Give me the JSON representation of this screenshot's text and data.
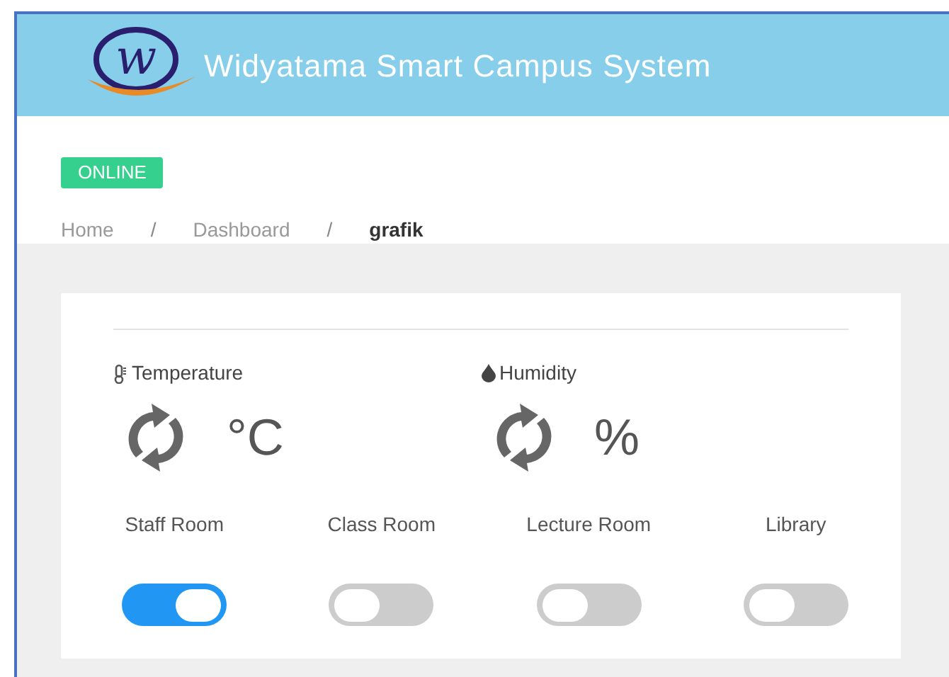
{
  "header": {
    "logo_letter": "w",
    "title": "Widyatama Smart Campus System"
  },
  "status_badge": "ONLINE",
  "breadcrumb": [
    {
      "label": "Home",
      "selected": false
    },
    {
      "label": "Dashboard",
      "selected": false
    },
    {
      "label": "grafik",
      "selected": true
    }
  ],
  "breadcrumb_separators": [
    "/",
    "/"
  ],
  "sensors": [
    {
      "kind": "temperature",
      "label": "Temperature",
      "unit": "°C"
    },
    {
      "kind": "humidity",
      "label": "Humidity",
      "unit": "%"
    }
  ],
  "rooms": [
    {
      "label": "Staff Room",
      "on": true
    },
    {
      "label": "Class Room",
      "on": false
    },
    {
      "label": "Lecture Room",
      "on": false
    },
    {
      "label": "Library",
      "on": false
    }
  ]
}
